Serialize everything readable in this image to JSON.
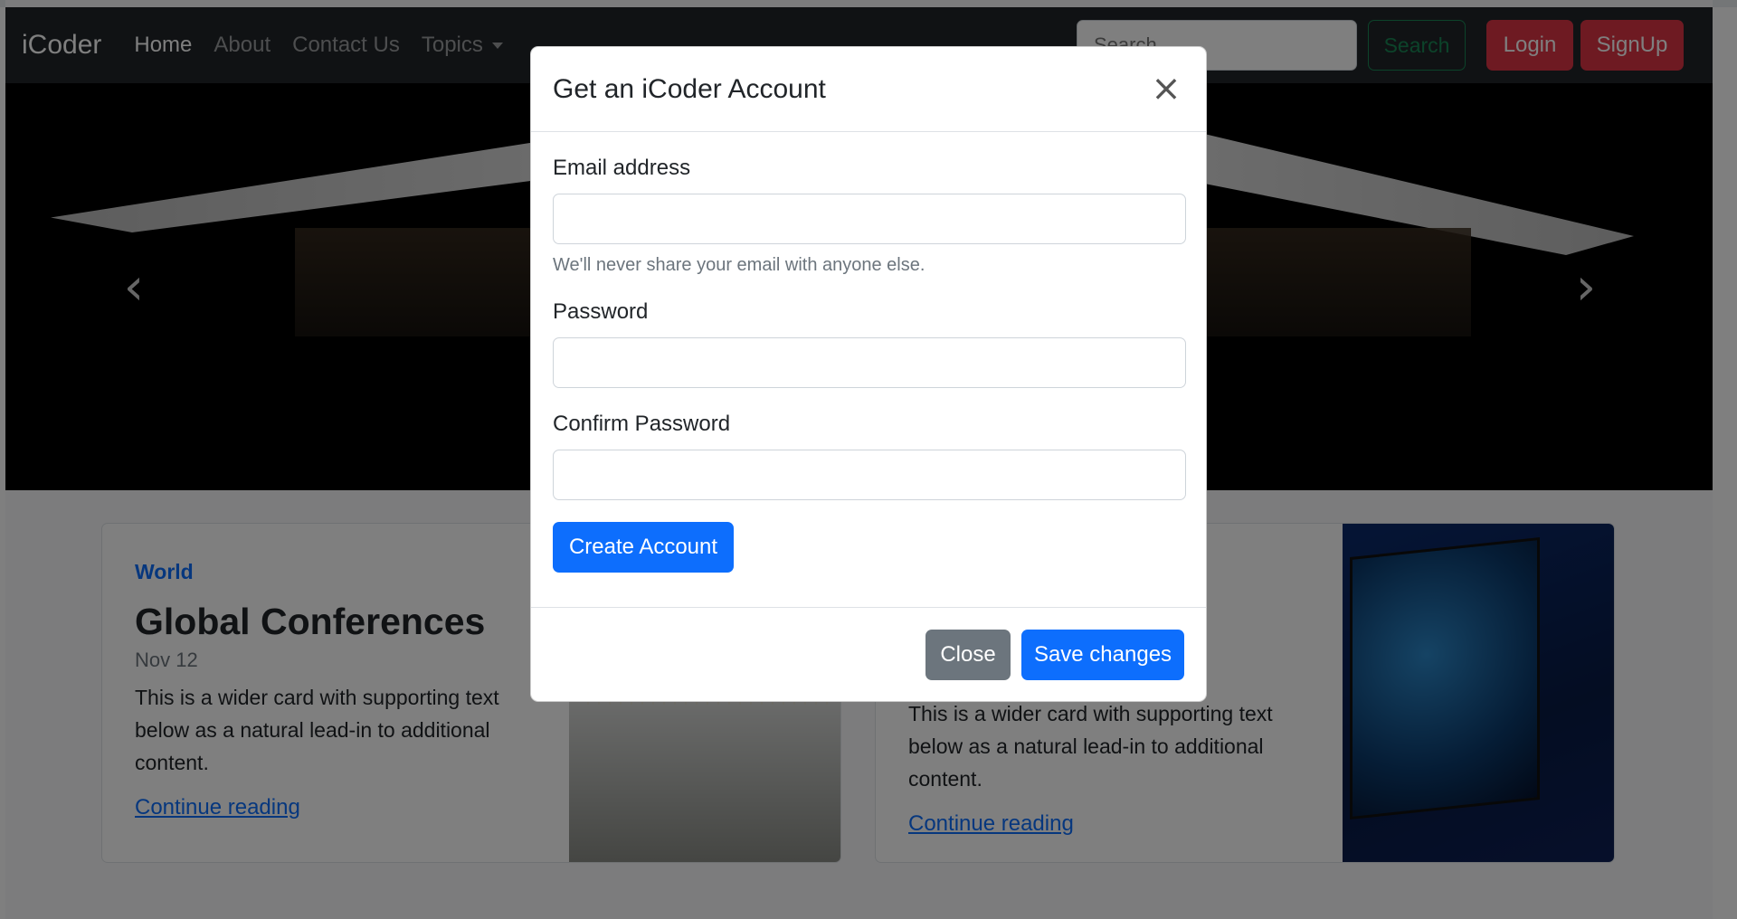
{
  "navbar": {
    "brand": "iCoder",
    "links": [
      "Home",
      "About",
      "Contact Us",
      "Topics"
    ],
    "search_placeholder": "Search",
    "search_button": "Search",
    "login": "Login",
    "signup": "SignUp"
  },
  "carousel": {
    "prev": "‹",
    "next": "›"
  },
  "cards": [
    {
      "category": "World",
      "title": "Global Conferences",
      "date": "Nov 12",
      "text": "This is a wider card with supporting text below as a natural lead-in to additional content.",
      "link": "Continue reading"
    },
    {
      "text": "This is a wider card with supporting text below as a natural lead-in to additional content.",
      "link": "Continue reading"
    }
  ],
  "modal": {
    "title": "Get an iCoder Account",
    "close_icon": "×",
    "email_label": "Email address",
    "email_help": "We'll never share your email with anyone else.",
    "password_label": "Password",
    "confirm_label": "Confirm Password",
    "create_button": "Create Account",
    "close_button": "Close",
    "save_button": "Save changes"
  },
  "colors": {
    "primary": "#0d6efd",
    "danger": "#dc3545",
    "success": "#198754",
    "secondary": "#6c757d",
    "navbar": "#212529"
  }
}
